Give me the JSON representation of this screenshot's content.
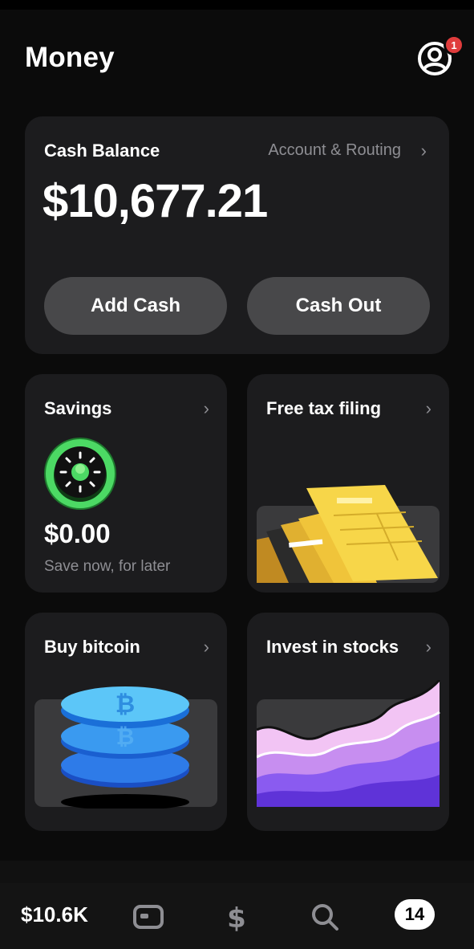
{
  "header": {
    "title": "Money",
    "notification_count": "1"
  },
  "balance": {
    "label": "Cash Balance",
    "account_link": "Account & Routing",
    "amount": "$10,677.21",
    "add_cash_label": "Add Cash",
    "cash_out_label": "Cash Out"
  },
  "tiles": {
    "savings": {
      "title": "Savings",
      "amount": "$0.00",
      "subtitle": "Save now, for later",
      "icon": "savings-vault-icon"
    },
    "tax": {
      "title": "Free tax filing",
      "icon": "tax-documents-illustration"
    },
    "bitcoin": {
      "title": "Buy bitcoin",
      "icon": "bitcoin-coins-illustration"
    },
    "stocks": {
      "title": "Invest in stocks",
      "icon": "stocks-waves-illustration"
    }
  },
  "tabbar": {
    "balance": "$10.6K",
    "activity_count": "14",
    "icons": [
      "card-icon",
      "dollar-icon",
      "search-icon"
    ]
  },
  "colors": {
    "background": "#0b0b0b",
    "card": "#1c1c1e",
    "pill": "#48484a",
    "muted_text": "#8e8e93",
    "savings_green": "#4cd964",
    "badge_red": "#e03c3c"
  }
}
